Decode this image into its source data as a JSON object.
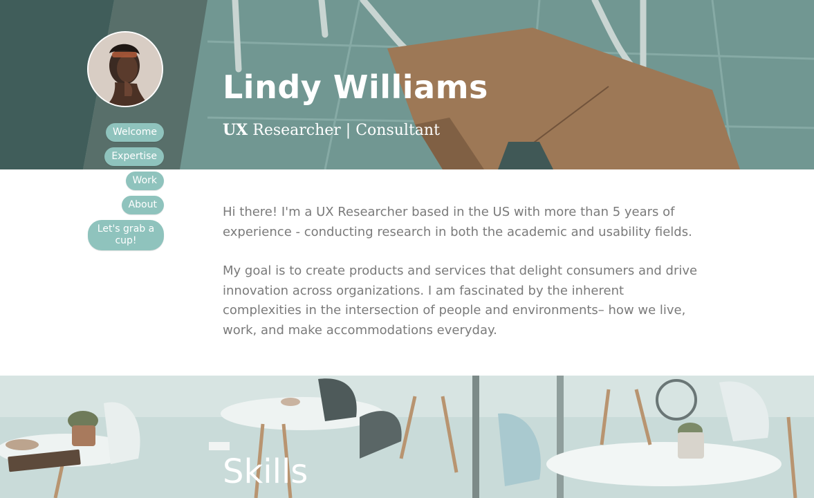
{
  "hero": {
    "name": "Lindy Williams",
    "role_strong": "UX",
    "role_rest": " Researcher | Consultant"
  },
  "nav": {
    "items": [
      {
        "label": "Welcome"
      },
      {
        "label": "Expertise"
      },
      {
        "label": "Work"
      },
      {
        "label": "About"
      },
      {
        "label": "Let's grab a cup!"
      }
    ]
  },
  "intro": {
    "paragraphs": [
      "Hi there! I'm a UX Researcher based in the US with more than 5 years of experience - conducting research in both the academic and usability fields.",
      "My goal is to create products and services that delight consumers and drive innovation across organizations. I am fascinated by the inherent complexities in the intersection of people and environments– how we live, work, and make accommodations everyday."
    ]
  },
  "skills": {
    "title": "Skills"
  },
  "colors": {
    "accent": "#8fc3bd",
    "body_text": "#7a7a7a",
    "hero_tint": "#6d8f8c"
  }
}
